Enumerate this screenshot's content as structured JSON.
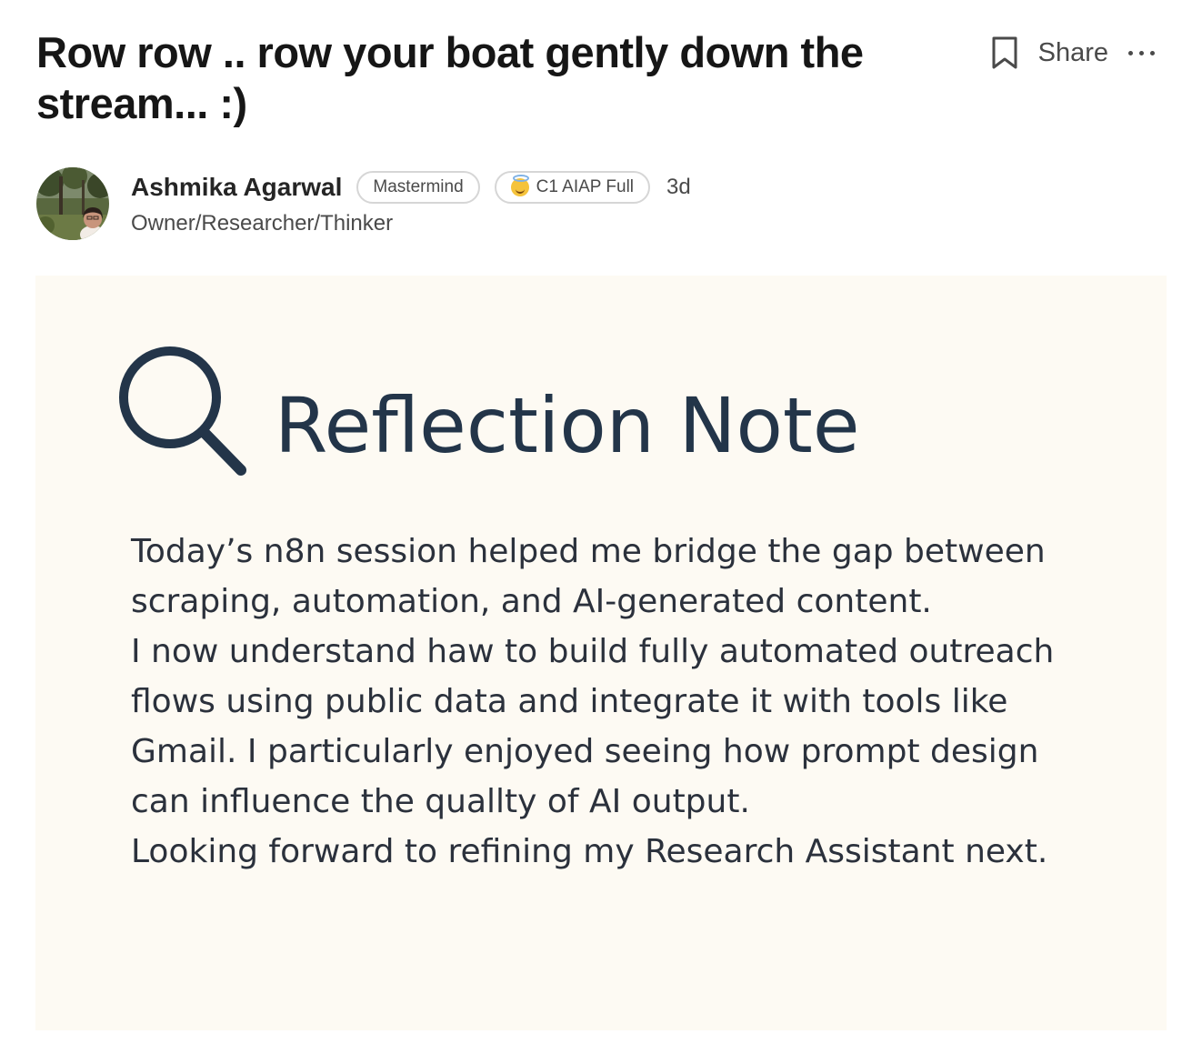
{
  "post": {
    "title": "Row row .. row your boat gently down the stream... :)",
    "actions": {
      "bookmark_icon": "bookmark-icon",
      "share_label": "Share",
      "more_icon": "more-options-icon"
    },
    "author": {
      "name": "Ashmika Agarwal",
      "role": "Owner/Researcher/Thinker",
      "badges": [
        {
          "label": "Mastermind"
        },
        {
          "label": "C1 AIAP Full",
          "icon": "smiling-face-with-halo-emoji"
        }
      ],
      "time_ago": "3d"
    }
  },
  "image": {
    "background": "#fdfaf3",
    "heading_icon": "magnifying-glass-icon",
    "heading": "Reflection Note",
    "accent_color": "#233549",
    "lines": [
      "Today’s n8n session helped me bridge the gap between",
      "scraping, automation, and AI-generated content.",
      "I now understand haw to build fully automated outreach",
      "flows using public data and integrate it with tools like",
      "Gmail. I particularly enjoyed seeing how prompt design",
      "can influence the quallty of AI output.",
      "Looking forward to refining my Research Assistant next."
    ]
  }
}
